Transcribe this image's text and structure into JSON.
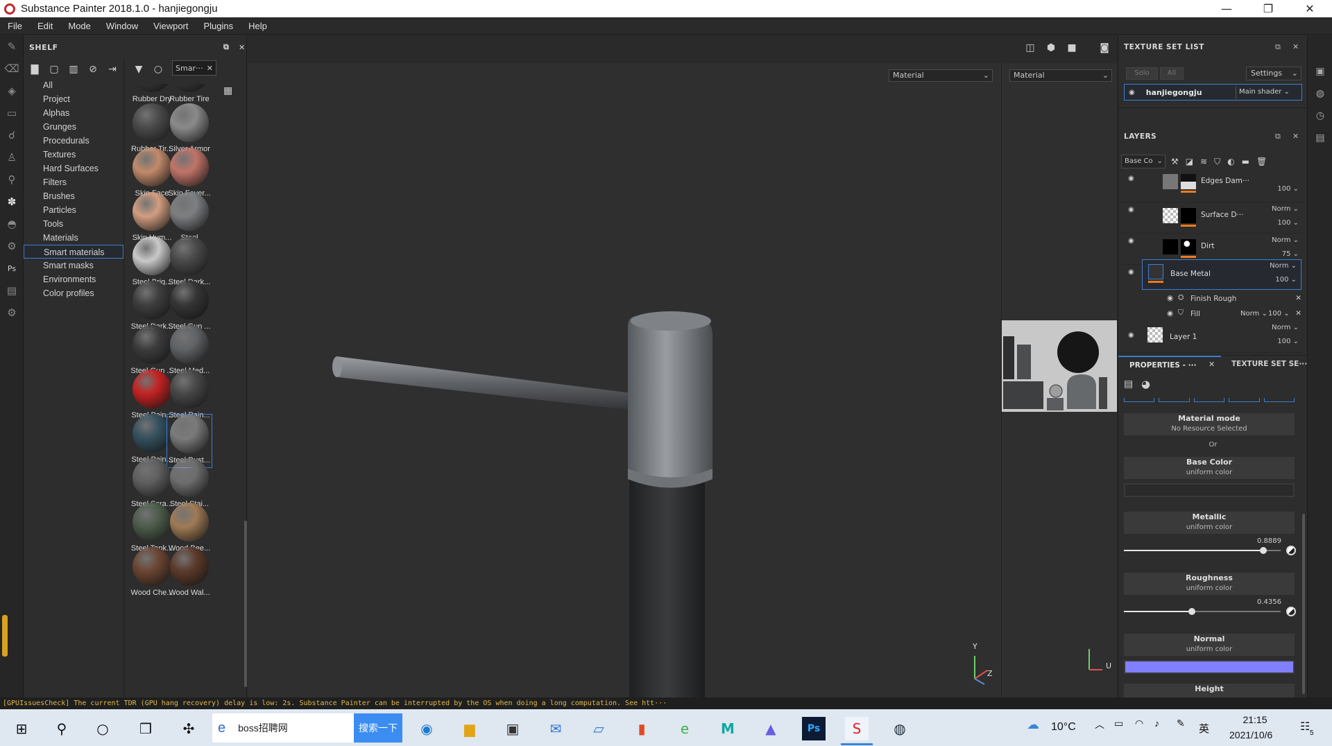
{
  "window": {
    "title": "Substance Painter 2018.1.0 - hanjiegongju",
    "min": "—",
    "restore": "❐",
    "close": "✕"
  },
  "menu": [
    "File",
    "Edit",
    "Mode",
    "Window",
    "Viewport",
    "Plugins",
    "Help"
  ],
  "shelf": {
    "title": "SHELF",
    "search_value": "Smar···",
    "categories": [
      "All",
      "Project",
      "Alphas",
      "Grunges",
      "Procedurals",
      "Textures",
      "Hard Surfaces",
      "Filters",
      "Brushes",
      "Particles",
      "Tools",
      "Materials",
      "Smart materials",
      "Smart masks",
      "Environments",
      "Color profiles"
    ],
    "selected_category": "Smart materials",
    "materials": [
      {
        "label": "Rubber Dry",
        "color": "#3a3a3a"
      },
      {
        "label": "Rubber Tire",
        "color": "#3a3a3a"
      },
      {
        "label": "Rubber Tir...",
        "color": "#4a4a4a"
      },
      {
        "label": "Silver Armor",
        "color": "#8a8a8a"
      },
      {
        "label": "Skin Face",
        "color": "#c28a6a"
      },
      {
        "label": "Skin Fever...",
        "color": "#c07468"
      },
      {
        "label": "Skin Hum...",
        "color": "#d29d80"
      },
      {
        "label": "Steel",
        "color": "#7c7f82"
      },
      {
        "label": "Steel Brig...",
        "color": "#c9c9c9"
      },
      {
        "label": "Steel Dark...",
        "color": "#4a4a4a"
      },
      {
        "label": "Steel Dark...",
        "color": "#3e3e3e"
      },
      {
        "label": "Steel Gun ...",
        "color": "#353535"
      },
      {
        "label": "Steel Gun ...",
        "color": "#3c3c3c"
      },
      {
        "label": "Steel Med...",
        "color": "#606366"
      },
      {
        "label": "Steel Pain...",
        "color": "#c42222"
      },
      {
        "label": "Steel Pain...",
        "color": "#474747"
      },
      {
        "label": "Steel Pain...",
        "color": "#34505e"
      },
      {
        "label": "Steel Rust...",
        "color": "#7a7a7a"
      },
      {
        "label": "Steel Scra...",
        "color": "#5f5f5f"
      },
      {
        "label": "Steel Stai...",
        "color": "#6d6d6d"
      },
      {
        "label": "Steel Tank...",
        "color": "#4c5c4a"
      },
      {
        "label": "Wood Bee...",
        "color": "#a07a55"
      },
      {
        "label": "Wood Che...",
        "color": "#6b4532"
      },
      {
        "label": "Wood Wal...",
        "color": "#5b3a2a"
      }
    ],
    "selected_material": "Steel Rust..."
  },
  "viewport": {
    "left_channel": "Material",
    "right_channel": "Material",
    "axis_y": "Y",
    "axis_z": "Z",
    "axis_u": "U"
  },
  "console": "[GPUIssuesCheck] The current TDR (GPU hang recovery) delay is low: 2s. Substance Painter can be interrupted by the OS when doing a long computation. See htt···",
  "texture_set_list": {
    "title": "TEXTURE SET LIST",
    "solo": "Solo",
    "all": "All",
    "settings": "Settings",
    "set_name": "hanjiegongju",
    "shader": "Main shader"
  },
  "layers": {
    "title": "LAYERS",
    "channel": "Base Co",
    "rows": [
      {
        "name": "Edges Dam···",
        "blend": "",
        "opacity": "100"
      },
      {
        "name": "Surface D···",
        "blend": "Norm",
        "opacity": "100"
      },
      {
        "name": "Dirt",
        "blend": "Norm",
        "opacity": "75"
      },
      {
        "name": "Base Metal",
        "blend": "Norm",
        "opacity": "100"
      },
      {
        "name": "Layer 1",
        "blend": "Norm",
        "opacity": "100"
      }
    ],
    "sub_effects": [
      {
        "name": "Finish Rough"
      },
      {
        "name": "Fill",
        "blend": "Norm",
        "opacity": "100"
      }
    ]
  },
  "properties": {
    "tab_props": "PROPERTIES - ···",
    "tab_tset": "TEXTURE SET SE···",
    "material_mode": "Material mode",
    "no_resource": "No Resource Selected",
    "or": "Or",
    "base_color": "Base Color",
    "uniform": "uniform color",
    "metallic": "Metallic",
    "metallic_value": "0.8889",
    "metallic_fraction": 0.8889,
    "roughness": "Roughness",
    "roughness_value": "0.4356",
    "roughness_fraction": 0.4356,
    "normal": "Normal",
    "height": "Height",
    "normal_color": "#8080ff"
  },
  "taskbar": {
    "search_text": "boss招聘网",
    "search_button": "搜索一下",
    "weather": "10°C",
    "ime": "英",
    "time": "21:15",
    "date": "2021/10/6",
    "notifications": "5"
  }
}
